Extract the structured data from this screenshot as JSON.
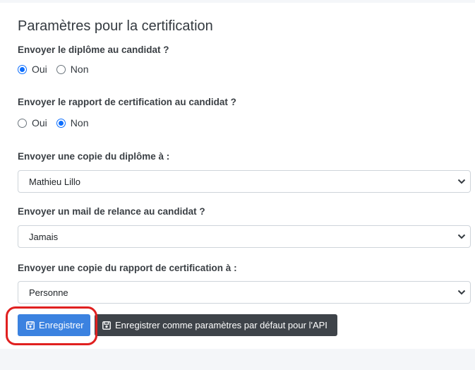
{
  "title": "Paramètres pour la certification",
  "diploma": {
    "question": "Envoyer le diplôme au candidat ?",
    "oui": "Oui",
    "non": "Non",
    "selected": "Oui"
  },
  "report": {
    "question": "Envoyer le rapport de certification au candidat ?",
    "oui": "Oui",
    "non": "Non",
    "selected": "Non"
  },
  "copy_diploma": {
    "question": "Envoyer une copie du diplôme à :",
    "value": "Mathieu Lillo"
  },
  "reminder": {
    "question": "Envoyer un mail de relance au candidat ?",
    "value": "Jamais"
  },
  "copy_report": {
    "question": "Envoyer une copie du rapport de certification à :",
    "value": "Personne"
  },
  "buttons": {
    "save": "Enregistrer",
    "save_default": "Enregistrer comme paramètres par défaut pour l'API"
  },
  "colors": {
    "primary": "#3b82e0",
    "dark": "#3e4349",
    "highlight": "#e02020"
  },
  "icons": {
    "save": "floppy-disk-icon",
    "select": "chevron-down-icon"
  }
}
